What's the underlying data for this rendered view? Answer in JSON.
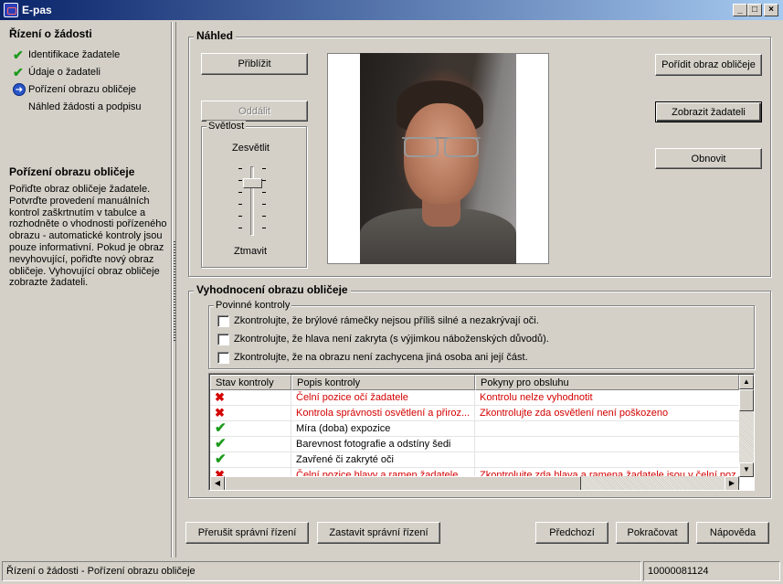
{
  "window": {
    "title": "E-pas",
    "controls": {
      "minimize": "_",
      "maximize": "□",
      "close": "×"
    }
  },
  "sidebar": {
    "title": "Řízení o žádosti",
    "steps": [
      {
        "label": "Identifikace žadatele",
        "state": "done",
        "icon": "check-icon"
      },
      {
        "label": "Údaje o žadateli",
        "state": "done",
        "icon": "check-icon"
      },
      {
        "label": "Pořízení obrazu obličeje",
        "state": "current",
        "icon": "arrow-right-icon"
      },
      {
        "label": "Náhled žádosti a podpisu",
        "state": "pending",
        "icon": ""
      }
    ],
    "help_title": "Pořízení obrazu obličeje",
    "help_text": "Pořiďte obraz obličeje žadatele. Potvrďte provedení manuálních kontrol zaškrtnutím v tabulce a rozhodněte o vhodnosti pořízeného obrazu - automatické kontroly jsou pouze informativní. Pokud je obraz nevyhovující, pořiďte nový obraz obličeje. Vyhovující obraz obličeje zobrazte žadateli."
  },
  "preview": {
    "title": "Náhled",
    "zoom_in": "Přiblížit",
    "zoom_out": "Oddálit",
    "brightness": {
      "title": "Světlost",
      "brighten": "Zesvětlit",
      "darken": "Ztmavit"
    },
    "capture": "Pořídit obraz obličeje",
    "show_applicant": "Zobrazit žadateli",
    "refresh": "Obnovit"
  },
  "evaluation": {
    "title": "Vyhodnocení obrazu obličeje",
    "mandatory_title": "Povinné kontroly",
    "checks": [
      {
        "label": "Zkontrolujte, že brýlové rámečky nejsou příliš silné a nezakrývají oči.",
        "checked": false
      },
      {
        "label": "Zkontrolujte, že hlava není zakryta (s výjimkou náboženských důvodů).",
        "checked": false
      },
      {
        "label": "Zkontrolujte, že na obrazu není zachycena jiná osoba ani její část.",
        "checked": false
      }
    ],
    "table": {
      "columns": [
        "Stav kontroly",
        "Popis kontroly",
        "Pokyny pro obsluhu"
      ],
      "rows": [
        {
          "status": "fail",
          "description": "Čelní pozice očí žadatele",
          "instructions": "Kontrolu nelze vyhodnotit"
        },
        {
          "status": "fail",
          "description": "Kontrola správnosti osvětlení a přiroz...",
          "instructions": "Zkontrolujte zda osvětlení není poškozeno"
        },
        {
          "status": "ok",
          "description": "Míra (doba) expozice",
          "instructions": ""
        },
        {
          "status": "ok",
          "description": "Barevnost fotografie a odstíny šedi",
          "instructions": ""
        },
        {
          "status": "ok",
          "description": "Zavřené či zakryté oči",
          "instructions": ""
        },
        {
          "status": "fail",
          "description": "Čelní pozice hlavy a ramen žadatele",
          "instructions": "Zkontrolujte zda hlava a ramena žadatele jsou v čelní poz"
        }
      ],
      "status_colors": {
        "fail": "#d40000",
        "ok": "#1c9a1c"
      }
    }
  },
  "footer": {
    "interrupt": "Přerušit správní řízení",
    "stop": "Zastavit správní řízení",
    "previous": "Předchozí",
    "continue": "Pokračovat",
    "help": "Nápověda"
  },
  "statusbar": {
    "path": "Řízení o žádosti -  Pořízení obrazu obličeje",
    "id": "10000081124"
  }
}
